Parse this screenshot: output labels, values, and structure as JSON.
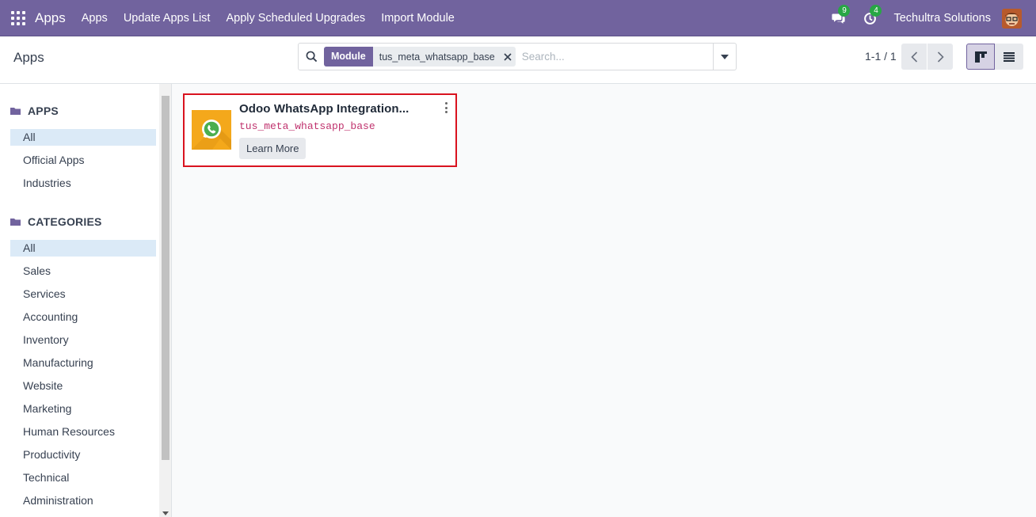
{
  "navbar": {
    "brand": "Apps",
    "menu": [
      "Apps",
      "Update Apps List",
      "Apply Scheduled Upgrades",
      "Import Module"
    ],
    "messages_badge": "9",
    "activities_badge": "4",
    "company": "Techultra Solutions"
  },
  "control_panel": {
    "title": "Apps",
    "facet_label": "Module",
    "facet_value": "tus_meta_whatsapp_base",
    "search_placeholder": "Search...",
    "pager": "1-1 / 1"
  },
  "sidebar": {
    "apps_header": "APPS",
    "apps_items": [
      "All",
      "Official Apps",
      "Industries"
    ],
    "categories_header": "CATEGORIES",
    "categories_items": [
      "All",
      "Sales",
      "Services",
      "Accounting",
      "Inventory",
      "Manufacturing",
      "Website",
      "Marketing",
      "Human Resources",
      "Productivity",
      "Technical",
      "Administration"
    ]
  },
  "card": {
    "title": "Odoo WhatsApp Integration...",
    "technical_name": "tus_meta_whatsapp_base",
    "button": "Learn More"
  },
  "colors": {
    "navbar": "#71639e",
    "card_border": "#d9121f",
    "icon_bg": "#f4a81b",
    "badge": "#28a745"
  }
}
